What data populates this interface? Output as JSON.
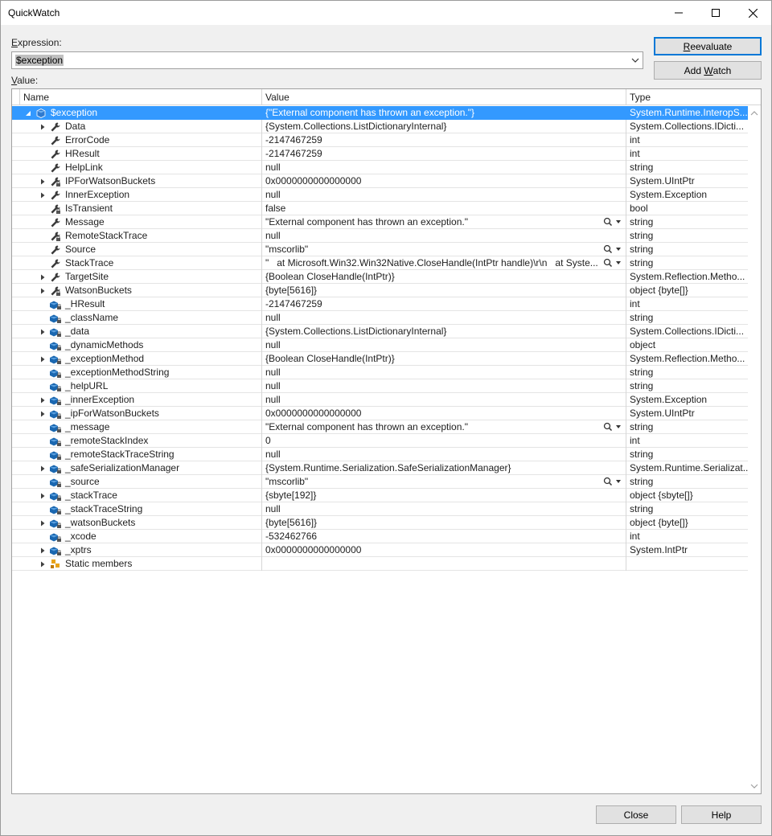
{
  "window": {
    "title": "QuickWatch"
  },
  "expression": {
    "label_prefix": "",
    "label_accel": "E",
    "label_rest": "xpression:",
    "value": "$exception"
  },
  "value_label": {
    "accel": "V",
    "rest": "alue:"
  },
  "buttons": {
    "reevaluate_accel": "R",
    "reevaluate_rest": "eevaluate",
    "add_watch_prefix": "Add ",
    "add_watch_accel": "W",
    "add_watch_rest": "atch",
    "close": "Close",
    "help": "Help"
  },
  "columns": {
    "name": "Name",
    "value": "Value",
    "type": "Type"
  },
  "colors": {
    "selection": "#3399ff",
    "accent": "#0078d7",
    "wrench": "#3a3a3a",
    "field": "#1a67b0"
  },
  "rows": [
    {
      "name": "$exception",
      "value": "{\"External component has thrown an exception.\"}",
      "type": "System.Runtime.InteropS...",
      "expander": "open",
      "icon": "exception-object-icon",
      "selected": true,
      "root": true,
      "search": false
    },
    {
      "name": "Data",
      "value": "{System.Collections.ListDictionaryInternal}",
      "type": "System.Collections.IDicti...",
      "expander": "closed",
      "icon": "wrench-property-icon",
      "search": false
    },
    {
      "name": "ErrorCode",
      "value": "-2147467259",
      "type": "int",
      "expander": "none",
      "icon": "wrench-property-icon",
      "search": false
    },
    {
      "name": "HResult",
      "value": "-2147467259",
      "type": "int",
      "expander": "none",
      "icon": "wrench-property-icon",
      "search": false
    },
    {
      "name": "HelpLink",
      "value": "null",
      "type": "string",
      "expander": "none",
      "icon": "wrench-property-icon",
      "search": false
    },
    {
      "name": "IPForWatsonBuckets",
      "value": "0x0000000000000000",
      "type": "System.UIntPtr",
      "expander": "closed",
      "icon": "private-property-icon",
      "search": false
    },
    {
      "name": "InnerException",
      "value": "null",
      "type": "System.Exception",
      "expander": "closed",
      "icon": "wrench-property-icon",
      "search": false
    },
    {
      "name": "IsTransient",
      "value": "false",
      "type": "bool",
      "expander": "none",
      "icon": "private-property-icon",
      "search": false
    },
    {
      "name": "Message",
      "value": "\"External component has thrown an exception.\"",
      "type": "string",
      "expander": "none",
      "icon": "wrench-property-icon",
      "search": true
    },
    {
      "name": "RemoteStackTrace",
      "value": "null",
      "type": "string",
      "expander": "none",
      "icon": "private-property-icon",
      "search": false
    },
    {
      "name": "Source",
      "value": "\"mscorlib\"",
      "type": "string",
      "expander": "none",
      "icon": "wrench-property-icon",
      "search": true
    },
    {
      "name": "StackTrace",
      "value": "\"   at Microsoft.Win32.Win32Native.CloseHandle(IntPtr handle)\\r\\n   at Syste...",
      "type": "string",
      "expander": "none",
      "icon": "wrench-property-icon",
      "search": true
    },
    {
      "name": "TargetSite",
      "value": "{Boolean CloseHandle(IntPtr)}",
      "type": "System.Reflection.Metho...",
      "expander": "closed",
      "icon": "wrench-property-icon",
      "search": false
    },
    {
      "name": "WatsonBuckets",
      "value": "{byte[5616]}",
      "type": "object {byte[]}",
      "expander": "closed",
      "icon": "private-property-icon",
      "search": false
    },
    {
      "name": "_HResult",
      "value": "-2147467259",
      "type": "int",
      "expander": "none",
      "icon": "private-field-icon",
      "search": false
    },
    {
      "name": "_className",
      "value": "null",
      "type": "string",
      "expander": "none",
      "icon": "private-field-icon",
      "search": false
    },
    {
      "name": "_data",
      "value": "{System.Collections.ListDictionaryInternal}",
      "type": "System.Collections.IDicti...",
      "expander": "closed",
      "icon": "private-field-icon",
      "search": false
    },
    {
      "name": "_dynamicMethods",
      "value": "null",
      "type": "object",
      "expander": "none",
      "icon": "private-field-icon",
      "search": false
    },
    {
      "name": "_exceptionMethod",
      "value": "{Boolean CloseHandle(IntPtr)}",
      "type": "System.Reflection.Metho...",
      "expander": "closed",
      "icon": "private-field-icon",
      "search": false
    },
    {
      "name": "_exceptionMethodString",
      "value": "null",
      "type": "string",
      "expander": "none",
      "icon": "private-field-icon",
      "search": false
    },
    {
      "name": "_helpURL",
      "value": "null",
      "type": "string",
      "expander": "none",
      "icon": "private-field-icon",
      "search": false
    },
    {
      "name": "_innerException",
      "value": "null",
      "type": "System.Exception",
      "expander": "closed",
      "icon": "private-field-icon",
      "search": false
    },
    {
      "name": "_ipForWatsonBuckets",
      "value": "0x0000000000000000",
      "type": "System.UIntPtr",
      "expander": "closed",
      "icon": "private-field-icon",
      "search": false
    },
    {
      "name": "_message",
      "value": "\"External component has thrown an exception.\"",
      "type": "string",
      "expander": "none",
      "icon": "private-field-icon",
      "search": true
    },
    {
      "name": "_remoteStackIndex",
      "value": "0",
      "type": "int",
      "expander": "none",
      "icon": "private-field-icon",
      "search": false
    },
    {
      "name": "_remoteStackTraceString",
      "value": "null",
      "type": "string",
      "expander": "none",
      "icon": "private-field-icon",
      "search": false
    },
    {
      "name": "_safeSerializationManager",
      "value": "{System.Runtime.Serialization.SafeSerializationManager}",
      "type": "System.Runtime.Serializat...",
      "expander": "closed",
      "icon": "private-field-icon",
      "search": false
    },
    {
      "name": "_source",
      "value": "\"mscorlib\"",
      "type": "string",
      "expander": "none",
      "icon": "private-field-icon",
      "search": true
    },
    {
      "name": "_stackTrace",
      "value": "{sbyte[192]}",
      "type": "object {sbyte[]}",
      "expander": "closed",
      "icon": "private-field-icon",
      "search": false
    },
    {
      "name": "_stackTraceString",
      "value": "null",
      "type": "string",
      "expander": "none",
      "icon": "private-field-icon",
      "search": false
    },
    {
      "name": "_watsonBuckets",
      "value": "{byte[5616]}",
      "type": "object {byte[]}",
      "expander": "closed",
      "icon": "private-field-icon",
      "search": false
    },
    {
      "name": "_xcode",
      "value": "-532462766",
      "type": "int",
      "expander": "none",
      "icon": "private-field-icon",
      "search": false
    },
    {
      "name": "_xptrs",
      "value": "0x0000000000000000",
      "type": "System.IntPtr",
      "expander": "closed",
      "icon": "private-field-icon",
      "search": false
    },
    {
      "name": "Static members",
      "value": "",
      "type": "",
      "expander": "closed",
      "icon": "static-members-icon",
      "search": false
    }
  ]
}
